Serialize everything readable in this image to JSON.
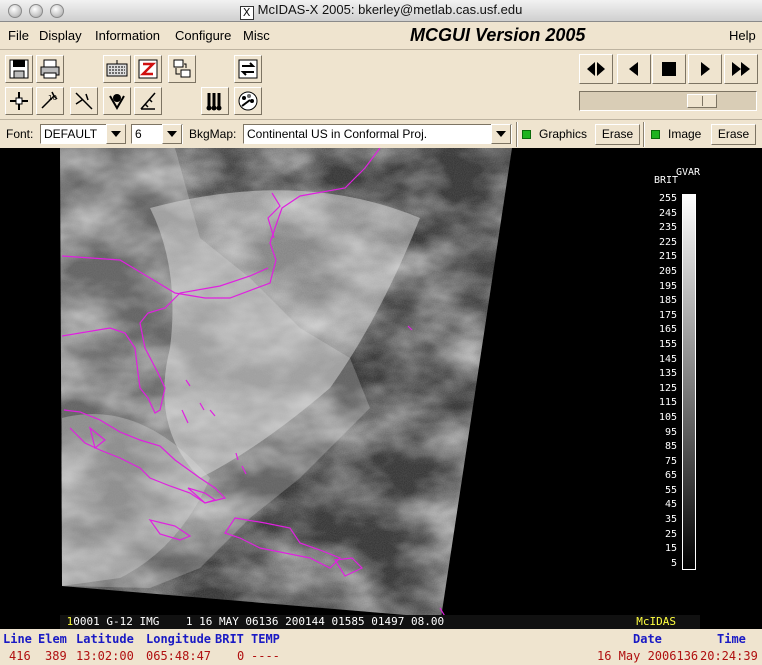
{
  "window": {
    "title": "McIDAS-X 2005: bkerley@metlab.cas.usf.edu"
  },
  "menu": {
    "items": [
      "File",
      "Display",
      "Information",
      "Configure",
      "Misc",
      "Help"
    ],
    "app_title": "MCGUI Version 2005"
  },
  "toolbar": {
    "icons": [
      "save-icon",
      "print-icon",
      "keyboard-icon",
      "zoom-icon",
      "transfer-icon",
      "loop-toggle-icon",
      "cursor-probe-icon",
      "wind-barb-icon",
      "meteogram-icon",
      "skew-t-icon",
      "station-plot-icon",
      "thermometers-icon",
      "palette-icon"
    ],
    "playback": [
      "step-both-icon",
      "step-back-icon",
      "stop-icon",
      "play-icon",
      "fast-forward-icon"
    ],
    "slider_value": 0.73
  },
  "options": {
    "font_label": "Font:",
    "font_value": "DEFAULT",
    "size_value": "6",
    "bkgmap_label": "BkgMap:",
    "bkgmap_value": "Continental US in Conformal Proj.",
    "graphics_label": "Graphics",
    "image_label": "Image",
    "erase_label": "Erase",
    "indicator_color": "#1fb31f"
  },
  "colorbar": {
    "title_top": "GVAR",
    "title_left": "BRIT",
    "labels": [
      "255",
      "245",
      "235",
      "225",
      "215",
      "205",
      "195",
      "185",
      "175",
      "165",
      "155",
      "145",
      "135",
      "125",
      "115",
      "105",
      "95",
      "85",
      "75",
      "65",
      "55",
      "45",
      "35",
      "25",
      "15",
      "5"
    ]
  },
  "image_info": {
    "frame": "1",
    "line": "0001 G-12 IMG    1 16 MAY 06136 200144 01585 01497 08.00",
    "brand": "McIDAS"
  },
  "status": {
    "headers": {
      "line": "Line",
      "elem": "Elem",
      "lat": "Latitude",
      "lon": "Longitude",
      "brit": "BRIT",
      "temp": "TEMP",
      "date": "Date",
      "time": "Time"
    },
    "values": {
      "line": "416",
      "elem": "389",
      "lat": "13:02:00",
      "lon": "065:48:47",
      "brit": "0",
      "temp": "----",
      "date": "16 May 2006136",
      "time": "20:24:39"
    }
  },
  "colors": {
    "map_outline": "#e020e0",
    "status_header": "#1a1ac4",
    "status_value": "#b01010",
    "accent": "#ffff40"
  }
}
